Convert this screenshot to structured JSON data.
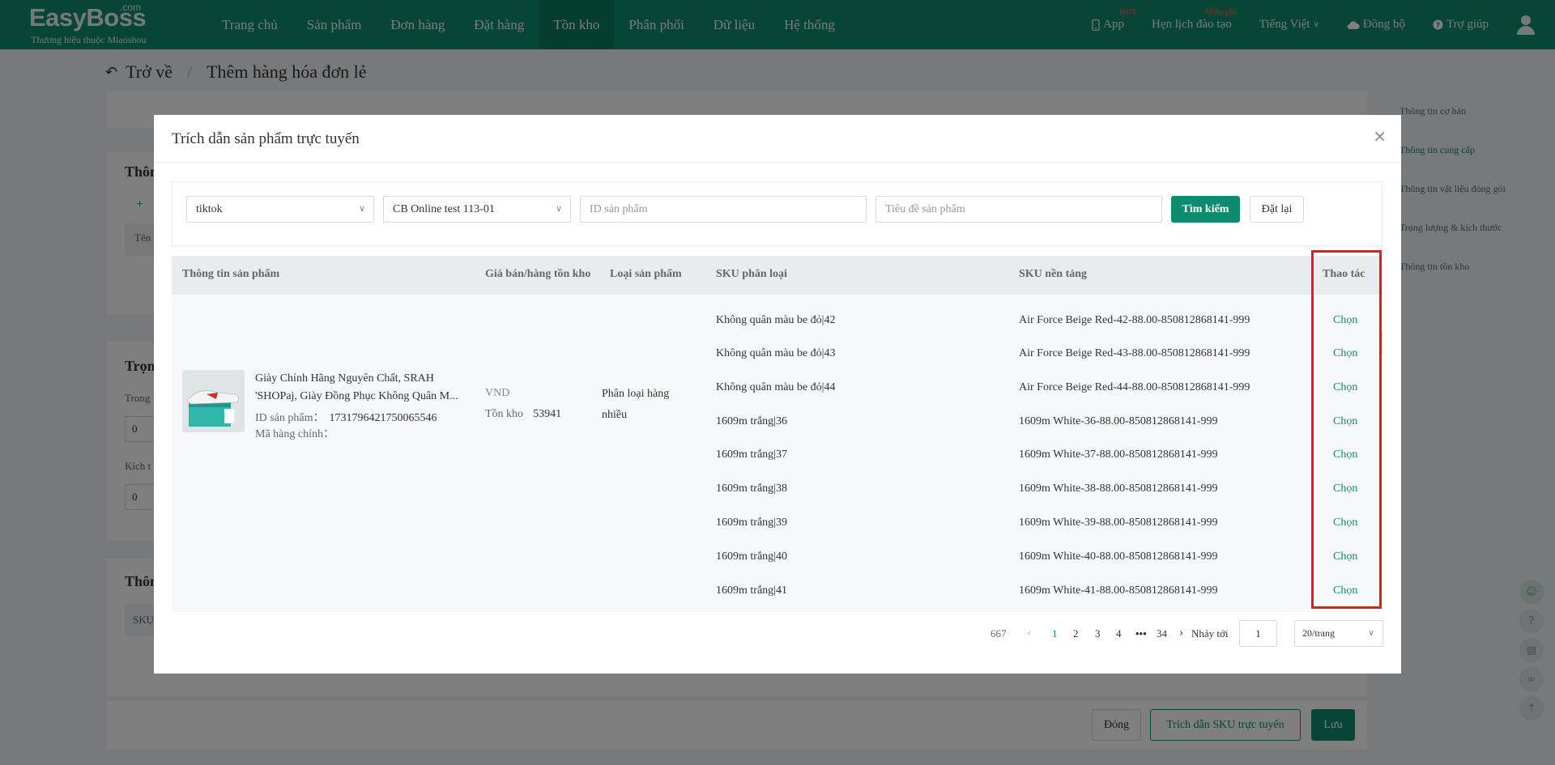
{
  "brand": {
    "logo": "EasyBoss",
    "logo_suffix": ".com",
    "tagline": "Thương hiệu thuộc Miaoshou"
  },
  "nav": {
    "items": [
      {
        "label": "Trang chủ"
      },
      {
        "label": "Sản phẩm"
      },
      {
        "label": "Đơn hàng"
      },
      {
        "label": "Đặt hàng"
      },
      {
        "label": "Tồn kho",
        "active": true
      },
      {
        "label": "Phân phối"
      },
      {
        "label": "Dữ liệu"
      },
      {
        "label": "Hệ thống"
      }
    ],
    "right": {
      "app": "App",
      "app_badge": "HOT",
      "training": "Hẹn lịch đào tạo",
      "training_badge": "Miễn phí",
      "language": "Tiếng Việt",
      "sync": "Đồng bộ",
      "help": "Trợ giúp"
    }
  },
  "page": {
    "back": "Trở về",
    "title": "Thêm hàng hóa đơn lẻ",
    "section_fragments": [
      "Thôn",
      "Trọn",
      "Thôn"
    ],
    "fragment_labels": [
      "Tên",
      "Trong",
      "Kích t",
      "SKU"
    ],
    "field_values": [
      "0",
      "0"
    ],
    "right_nav": [
      "Thông tin cơ bản",
      "Thông tin cung cấp",
      "Thông tin vật liệu đóng gói",
      "Trọng lượng & kích thước",
      "Thông tin tồn kho"
    ],
    "right_nav_active": 1,
    "bottom": {
      "close": "Đóng",
      "quote_sku": "Trích dẫn SKU trực tuyến",
      "save": "Lưu"
    }
  },
  "modal": {
    "title": "Trích dẫn sản phẩm trực tuyến",
    "filters": {
      "platform": "tiktok",
      "store": "CB Online test 113-01",
      "product_id_placeholder": "ID sản phẩm",
      "title_placeholder": "Tiêu đề sản phẩm",
      "search": "Tìm kiếm",
      "reset": "Đặt lại"
    },
    "columns": {
      "product_info": "Thông tin sản phẩm",
      "price_stock": "Giá bán/hàng tồn kho",
      "product_type": "Loại sản phẩm",
      "sku_variant": "SKU phân loại",
      "sku_platform": "SKU nền tảng",
      "action": "Thao tác"
    },
    "product": {
      "title_line1": "Giày Chính Hãng Nguyên Chất, SRAH",
      "title_line2": "'SHOPaj, Giày Đồng Phục Không Quân M...",
      "id_label": "ID sản phẩm：",
      "id_value": "1731796421750065546",
      "code_label": "Mã hàng chính：",
      "currency": "VND",
      "stock_label": "Tồn kho",
      "stock_value": "53941",
      "type": "Phân loại hàng nhiều"
    },
    "sku_rows": [
      {
        "variant": "Không quân màu be đỏ|42",
        "platform_sku": "Air Force Beige Red-42-88.00-850812868141-999",
        "action": "Chọn"
      },
      {
        "variant": "Không quân màu be đỏ|43",
        "platform_sku": "Air Force Beige Red-43-88.00-850812868141-999",
        "action": "Chọn"
      },
      {
        "variant": "Không quân màu be đỏ|44",
        "platform_sku": "Air Force Beige Red-44-88.00-850812868141-999",
        "action": "Chọn"
      },
      {
        "variant": "1609m trắng|36",
        "platform_sku": "1609m White-36-88.00-850812868141-999",
        "action": "Chọn"
      },
      {
        "variant": "1609m trắng|37",
        "platform_sku": "1609m White-37-88.00-850812868141-999",
        "action": "Chọn"
      },
      {
        "variant": "1609m trắng|38",
        "platform_sku": "1609m White-38-88.00-850812868141-999",
        "action": "Chọn"
      },
      {
        "variant": "1609m trắng|39",
        "platform_sku": "1609m White-39-88.00-850812868141-999",
        "action": "Chọn"
      },
      {
        "variant": "1609m trắng|40",
        "platform_sku": "1609m White-40-88.00-850812868141-999",
        "action": "Chọn"
      },
      {
        "variant": "1609m trắng|41",
        "platform_sku": "1609m White-41-88.00-850812868141-999",
        "action": "Chọn"
      }
    ],
    "pagination": {
      "total": "667",
      "pages": [
        "1",
        "2",
        "3",
        "4",
        "•••",
        "34"
      ],
      "current": "1",
      "jump_label": "Nhảy tới",
      "jump_value": "1",
      "page_size": "20/trang"
    }
  },
  "colors": {
    "brand": "#0e8a6e",
    "highlight": "#e51a1a"
  }
}
